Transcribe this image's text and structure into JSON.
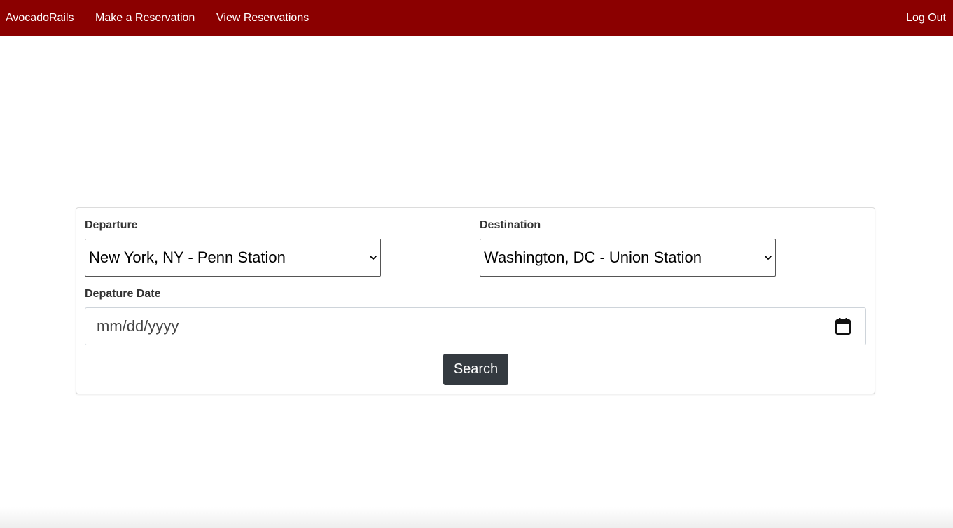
{
  "nav": {
    "brand": "AvocadoRails",
    "make_reservation": "Make a Reservation",
    "view_reservations": "View Reservations",
    "logout": "Log Out"
  },
  "colors": {
    "navbar": "#8b0000",
    "button": "#343a40"
  },
  "form": {
    "departure_label": "Departure",
    "departure_value": "New York, NY - Penn Station",
    "destination_label": "Destination",
    "destination_value": "Washington, DC - Union Station",
    "date_label": "Depature Date",
    "date_placeholder": "mm/dd/yyyy",
    "search_label": "Search"
  },
  "icons": {
    "select_arrow": "chevron-down-icon",
    "date_picker": "calendar-icon"
  }
}
